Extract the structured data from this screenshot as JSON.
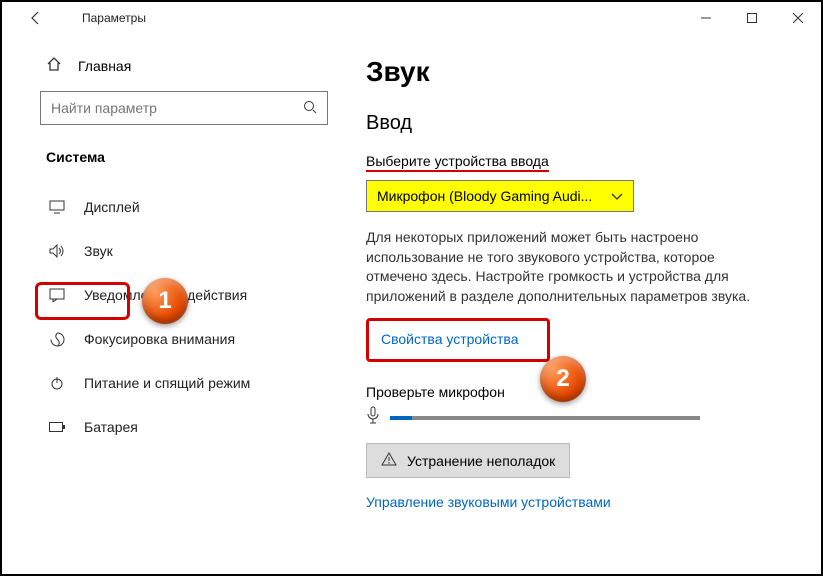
{
  "titlebar": {
    "title": "Параметры"
  },
  "sidebar": {
    "home": "Главная",
    "search_placeholder": "Найти параметр",
    "group": "Система",
    "items": [
      {
        "label": "Дисплей"
      },
      {
        "label": "Звук"
      },
      {
        "label": "Уведомления и действия"
      },
      {
        "label": "Фокусировка внимания"
      },
      {
        "label": "Питание и спящий режим"
      },
      {
        "label": "Батарея"
      }
    ]
  },
  "content": {
    "page_title": "Звук",
    "section_title": "Ввод",
    "field_label": "Выберите устройства ввода",
    "dropdown_value": "Микрофон (Bloody Gaming Audi...",
    "description": "Для некоторых приложений может быть настроено использование не того звукового устройства, которое отмечено здесь. Настройте громкость и устройства для приложений в разделе дополнительных параметров звука.",
    "device_props_link": "Свойства устройства",
    "check_label": "Проверьте микрофон",
    "troubleshoot": "Устранение неполадок",
    "manage_link": "Управление звуковыми устройствами"
  },
  "markers": {
    "m1": "1",
    "m2": "2"
  }
}
